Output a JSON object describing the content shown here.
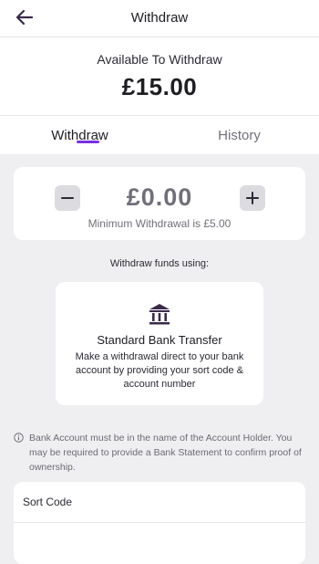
{
  "header": {
    "title": "Withdraw",
    "back_icon": "arrow-left-icon"
  },
  "balance": {
    "label": "Available To Withdraw",
    "amount": "£15.00"
  },
  "tabs": [
    {
      "label": "Withdraw",
      "active": true
    },
    {
      "label": "History",
      "active": false
    }
  ],
  "amount_entry": {
    "value": "£0.00",
    "minimum_text": "Minimum Withdrawal is £5.00",
    "decrease_icon": "minus-icon",
    "increase_icon": "plus-icon"
  },
  "methods": {
    "heading": "Withdraw funds using:",
    "items": [
      {
        "title": "Standard Bank Transfer",
        "description": "Make a withdrawal direct to your bank account by providing your sort code & account number",
        "icon": "bank-icon"
      }
    ]
  },
  "notice": {
    "icon": "info-icon",
    "text": "Bank Account must be in the name of the Account Holder. You may be required to provide a Bank Statement to confirm proof of ownership."
  },
  "form": {
    "sort_code_label": "Sort Code"
  },
  "colors": {
    "accent": "#7a2fe0",
    "icon_dark": "#3a2a4a",
    "background": "#efeff1"
  }
}
